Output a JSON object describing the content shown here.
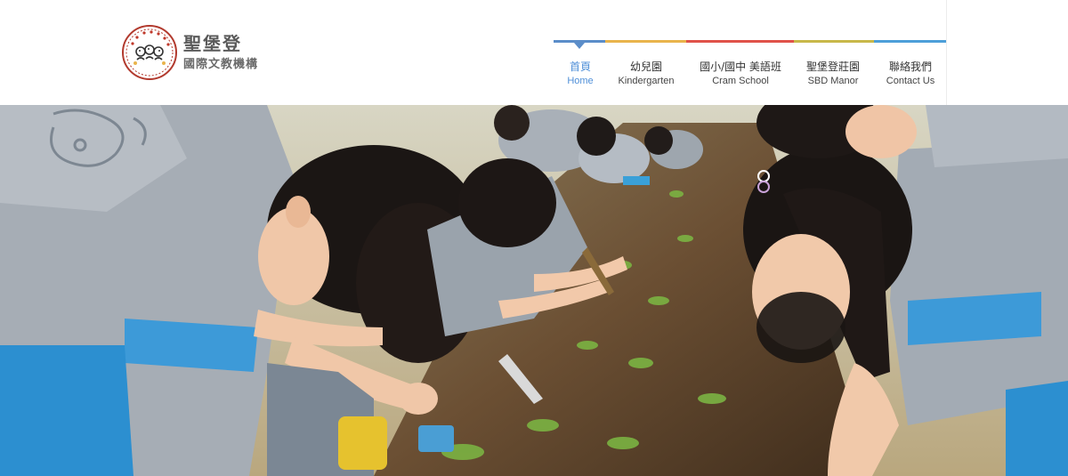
{
  "site": {
    "logo": {
      "name_line1": "聖堡登",
      "name_line2": "國際文教機構",
      "badge_text": "SD'SCHOOL"
    }
  },
  "nav": {
    "accent_colors": [
      "#5b8dc9",
      "#e9b44c",
      "#e0524a",
      "#c8b84a",
      "#4d9fd9"
    ],
    "items": [
      {
        "zh": "首頁",
        "en": "Home",
        "active": true
      },
      {
        "zh": "幼兒園",
        "en": "Kindergarten",
        "active": false
      },
      {
        "zh": "國小/國中 美語班",
        "en": "Cram School",
        "active": false
      },
      {
        "zh": "聖堡登莊園",
        "en": "SBD Manor",
        "active": false
      },
      {
        "zh": "聯絡我們",
        "en": "Contact Us",
        "active": false
      }
    ]
  },
  "hero": {
    "image": "children-planting-in-field"
  }
}
